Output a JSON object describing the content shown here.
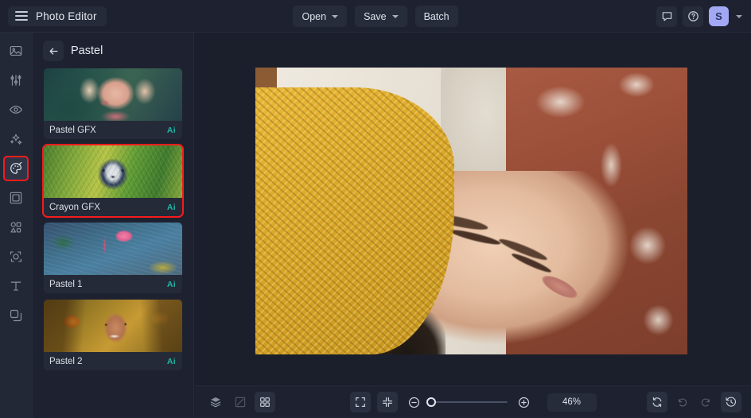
{
  "app": {
    "title": "Photo Editor",
    "accent_red": "#f61b1b",
    "ai_badge_color": "#1fb6a6",
    "avatar_bg": "#a3a8f5"
  },
  "topbar": {
    "menu_icon": "hamburger-icon",
    "open_label": "Open",
    "save_label": "Save",
    "batch_label": "Batch",
    "feedback_icon": "chat-bubble-icon",
    "help_icon": "question-circle-icon",
    "avatar_initial": "S",
    "account_caret_icon": "chevron-down-icon"
  },
  "rail": {
    "items": [
      {
        "name": "image",
        "icon": "image-icon",
        "active": false
      },
      {
        "name": "adjust",
        "icon": "sliders-icon",
        "active": false
      },
      {
        "name": "retouch",
        "icon": "eye-icon",
        "active": false
      },
      {
        "name": "effects",
        "icon": "sparkles-icon",
        "active": false
      },
      {
        "name": "styles",
        "icon": "palette-icon",
        "active": true
      },
      {
        "name": "frames",
        "icon": "frame-icon",
        "active": false
      },
      {
        "name": "shapes",
        "icon": "shapes-icon",
        "active": false
      },
      {
        "name": "mask",
        "icon": "mask-icon",
        "active": false
      },
      {
        "name": "text",
        "icon": "text-icon",
        "active": false
      },
      {
        "name": "layers",
        "icon": "layers-copy-icon",
        "active": false
      }
    ]
  },
  "panel": {
    "back_icon": "arrow-left-icon",
    "title": "Pastel",
    "presets": [
      {
        "label": "Pastel GFX",
        "badge": "Ai",
        "art": "t-pastelgfx",
        "selected": false
      },
      {
        "label": "Crayon GFX",
        "badge": "Ai",
        "art": "t-crayon",
        "selected": true
      },
      {
        "label": "Pastel 1",
        "badge": "Ai",
        "art": "t-pastel1",
        "selected": false
      },
      {
        "label": "Pastel 2",
        "badge": "Ai",
        "art": "t-pastel2",
        "selected": false
      }
    ]
  },
  "canvas": {
    "image_description": "Woman resting with yellow knit blanket and rust floral fabric"
  },
  "bottombar": {
    "left_tools": [
      {
        "name": "layers",
        "icon": "layers-icon",
        "active": false
      },
      {
        "name": "compare",
        "icon": "compare-split-icon",
        "active": false
      },
      {
        "name": "grid",
        "icon": "grid-icon",
        "active": true
      }
    ],
    "fit_icon": "fit-screen-icon",
    "shrink_icon": "collapse-icon",
    "zoom_out_icon": "minus-circle-icon",
    "zoom_in_icon": "plus-circle-icon",
    "zoom_value": "46%",
    "right_tools": [
      {
        "name": "reset",
        "icon": "reset-icon",
        "active": true
      },
      {
        "name": "undo",
        "icon": "undo-icon",
        "active": false
      },
      {
        "name": "redo",
        "icon": "redo-icon",
        "active": false
      },
      {
        "name": "history",
        "icon": "history-clock-icon",
        "active": true
      }
    ]
  }
}
